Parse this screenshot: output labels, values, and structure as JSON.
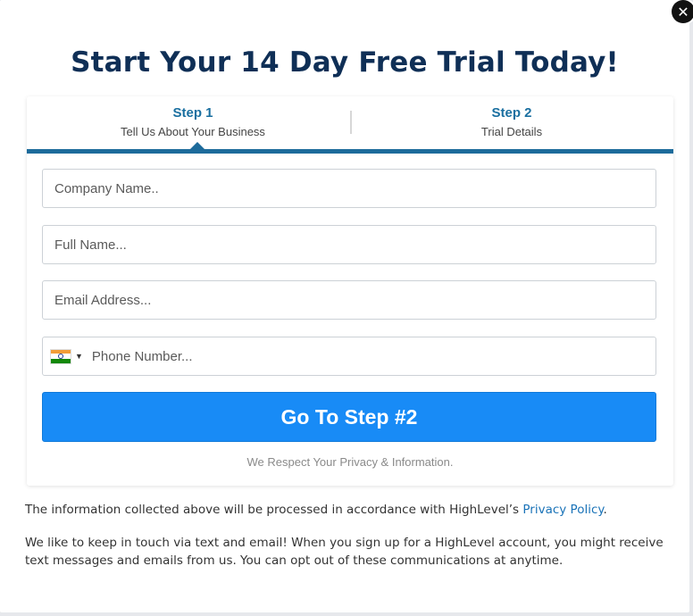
{
  "close": {
    "icon": "close-icon",
    "glyph": "✕"
  },
  "headline": "Start Your 14 Day Free Trial Today!",
  "steps": [
    {
      "num": "Step 1",
      "desc": "Tell Us About Your Business",
      "active": true
    },
    {
      "num": "Step 2",
      "desc": "Trial Details",
      "active": false
    }
  ],
  "form": {
    "company_placeholder": "Company Name..",
    "name_placeholder": "Full Name...",
    "email_placeholder": "Email Address...",
    "phone_placeholder": "Phone Number...",
    "phone_country_flag": "india-flag-icon",
    "submit_label": "Go To Step #2",
    "privacy_note": "We Respect Your Privacy & Information."
  },
  "legal": {
    "line1_prefix": "The information collected above will be processed in accordance with HighLevel’s ",
    "line1_link": "Privacy Policy",
    "line1_suffix": ".",
    "line2": "We like to keep in touch via text and email! When you sign up for a HighLevel account, you might receive text messages and emails from us. You can opt out of these communications at anytime."
  },
  "colors": {
    "headline": "#0f2f56",
    "step_accent": "#1d6b9b",
    "button": "#188bf6",
    "link": "#1a73b8"
  }
}
